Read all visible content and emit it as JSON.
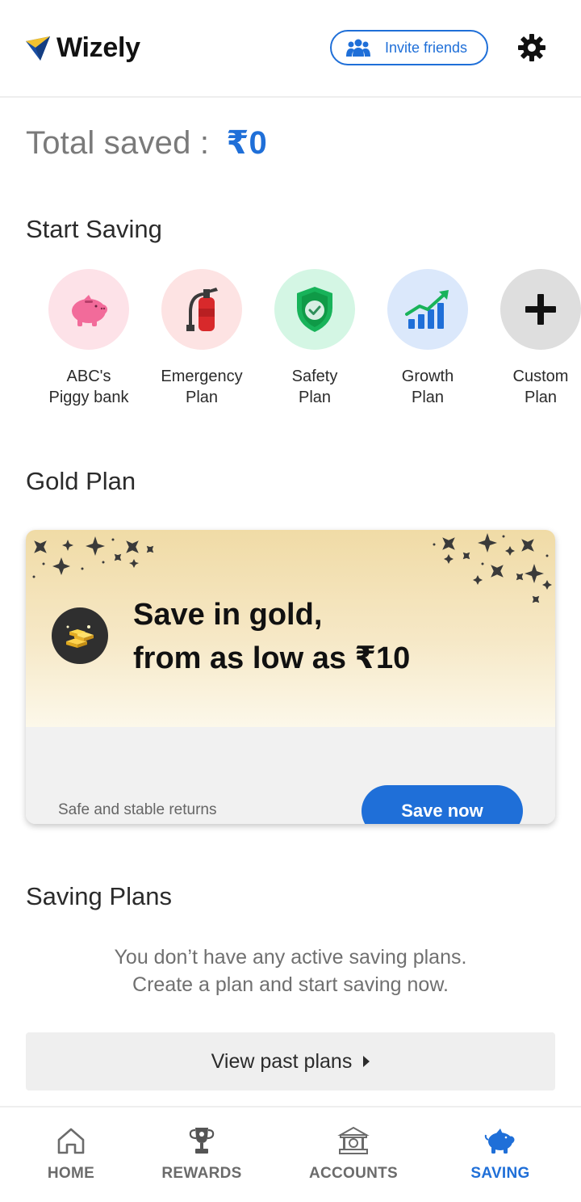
{
  "app": {
    "name": "Wizely",
    "invite_label": "Invite friends",
    "icons": {
      "logo": "wizely-logo-icon",
      "invite": "people-group-icon",
      "settings": "gear-icon"
    }
  },
  "summary": {
    "total_label": "Total saved :",
    "total_value": "₹0"
  },
  "start_saving": {
    "title": "Start Saving",
    "plans": [
      {
        "line1": "ABC's",
        "line2": "Piggy bank",
        "icon": "piggy-bank-icon",
        "bg": "#fde2e8"
      },
      {
        "line1": "Emergency",
        "line2": "Plan",
        "icon": "fire-extinguisher-icon",
        "bg": "#fde3e3"
      },
      {
        "line1": "Safety",
        "line2": "Plan",
        "icon": "shield-check-icon",
        "bg": "#d4f6e4"
      },
      {
        "line1": "Growth",
        "line2": "Plan",
        "icon": "growth-chart-icon",
        "bg": "#dbe8fb"
      },
      {
        "line1": "Custom",
        "line2": "Plan",
        "icon": "plus-icon",
        "bg": "#dedede"
      }
    ]
  },
  "gold_plan": {
    "title": "Gold Plan",
    "headline_line1": "Save in gold,",
    "headline_line2": "from as low as ₹10",
    "subtext": "Safe and stable returns",
    "cta": "Save now",
    "icon": "gold-bars-icon"
  },
  "saving_plans": {
    "title": "Saving Plans",
    "empty_line1": "You don’t have any active saving plans.",
    "empty_line2": "Create a plan and start saving now.",
    "past_plans_label": "View past plans"
  },
  "bottom_nav": {
    "items": [
      {
        "label": "HOME",
        "icon": "home-icon"
      },
      {
        "label": "REWARDS",
        "icon": "trophy-icon"
      },
      {
        "label": "ACCOUNTS",
        "icon": "bank-icon"
      },
      {
        "label": "SAVING",
        "icon": "piggy-bank-icon",
        "active": true
      }
    ]
  },
  "colors": {
    "accent": "#1f6fd8",
    "text_dark": "#2b2b2b",
    "text_muted": "#7a7a7a",
    "gold_gradient_top": "#f0dba6"
  }
}
